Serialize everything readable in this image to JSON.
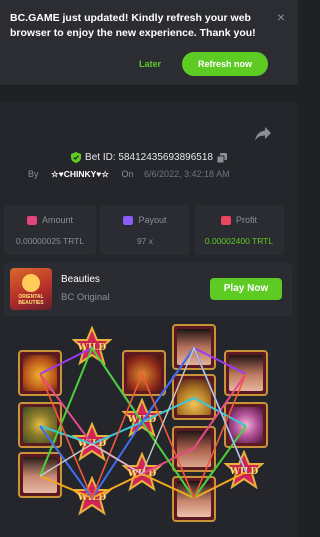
{
  "notification": {
    "message": "BC.GAME just updated! Kindly refresh your web browser to enjoy the new experience. Thank you!",
    "close_glyph": "×",
    "later_label": "Later",
    "refresh_label": "Refresh now"
  },
  "bet": {
    "id_label": "Bet ID: 58412435693896518",
    "by_label": "By",
    "user": "☆♥CHINKY♥☆",
    "on_label": "On",
    "datetime": "6/6/2022, 3:42:18 AM"
  },
  "stats": [
    {
      "label": "Amount",
      "value": "0.00000025 TRTL",
      "icon": "amount-icon",
      "color": "#e0457b"
    },
    {
      "label": "Payout",
      "value": "97 x",
      "icon": "payout-icon",
      "color": "#8a5cf5"
    },
    {
      "label": "Profit",
      "value": "0.00002400 TRTL",
      "icon": "profit-icon",
      "color": "#e94560"
    }
  ],
  "game": {
    "name": "Beauties",
    "provider": "BC Original",
    "thumb_text": "ORIENTAL BEAUTIES",
    "play_label": "Play Now"
  },
  "reels": {
    "wild_label": "WILD"
  },
  "colors": {
    "accent": "#5ecb25",
    "background": "#1f2125",
    "panel": "#2a2c31"
  }
}
